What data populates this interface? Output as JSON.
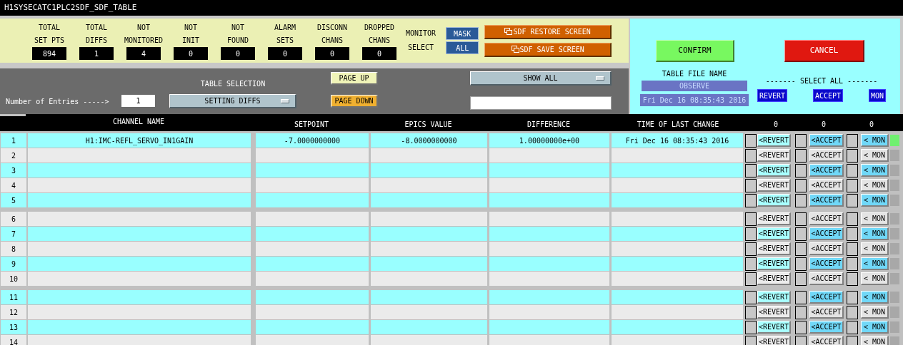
{
  "window": {
    "title": "H1SYSECATC1PLC2SDF_SDF_TABLE"
  },
  "stats": [
    {
      "label_1": "TOTAL",
      "label_2": "SET PTS",
      "value": "894"
    },
    {
      "label_1": "TOTAL",
      "label_2": "DIFFS",
      "value": "1"
    },
    {
      "label_1": "NOT",
      "label_2": "MONITORED",
      "value": "4"
    },
    {
      "label_1": "NOT",
      "label_2": "INIT",
      "value": "0"
    },
    {
      "label_1": "NOT",
      "label_2": "FOUND",
      "value": "0"
    },
    {
      "label_1": "ALARM",
      "label_2": "SETS",
      "value": "0"
    },
    {
      "label_1": "DISCONN",
      "label_2": "CHANS",
      "value": "0"
    },
    {
      "label_1": "DROPPED",
      "label_2": "CHANS",
      "value": "0"
    }
  ],
  "monitor_select": {
    "label_1": "MONITOR",
    "label_2": "SELECT",
    "buttons": [
      "MASK",
      "ALL"
    ]
  },
  "sdf_buttons": [
    "SDF RESTORE SCREEN",
    "SDF SAVE SCREEN"
  ],
  "confirm": "CONFIRM",
  "cancel": "CANCEL",
  "table_file": {
    "label": "TABLE FILE NAME",
    "name": "OBSERVE",
    "time": "Fri Dec 16 08:35:43 2016"
  },
  "select_all": {
    "label": "------- SELECT ALL -------",
    "buttons": [
      "REVERT",
      "ACCEPT",
      "MON"
    ]
  },
  "entries": {
    "label": "Number of Entries ----->",
    "value": "1"
  },
  "table_selection": {
    "label": "TABLE SELECTION",
    "value": "SETTING DIFFS"
  },
  "paging": [
    "PAGE UP",
    "PAGE DOWN"
  ],
  "filter": {
    "value": "SHOW ALL"
  },
  "table": {
    "columns": [
      "CHANNEL NAME",
      "SETPOINT",
      "EPICS VALUE",
      "DIFFERENCE",
      "TIME OF LAST CHANGE"
    ],
    "counts": [
      "0",
      "0",
      "0"
    ],
    "rows": [
      {
        "number": "1",
        "channel": "H1:IMC-REFL_SERVO_IN1GAIN",
        "setpoint": "-7.0000000000",
        "epics_value": "-8.0000000000",
        "difference": "1.00000000e+00",
        "time": "Fri Dec 16 08:35:43 2016",
        "highlighted": true,
        "status_on": true,
        "checks": [
          false,
          false,
          false
        ],
        "buttons": [
          "<REVERT",
          "<ACCEPT",
          "< MON"
        ]
      },
      {
        "number": "2",
        "highlighted": false,
        "status_on": false,
        "checks": [
          false,
          false,
          false
        ],
        "buttons": [
          "<REVERT",
          "<ACCEPT",
          "< MON"
        ]
      },
      {
        "number": "3",
        "highlighted": true,
        "status_on": false,
        "checks": [
          false,
          false,
          false
        ],
        "buttons": [
          "<REVERT",
          "<ACCEPT",
          "< MON"
        ]
      },
      {
        "number": "4",
        "highlighted": false,
        "status_on": false,
        "checks": [
          false,
          false,
          false
        ],
        "buttons": [
          "<REVERT",
          "<ACCEPT",
          "< MON"
        ]
      },
      {
        "number": "5",
        "highlighted": true,
        "status_on": false,
        "checks": [
          false,
          false,
          false
        ],
        "buttons": [
          "<REVERT",
          "<ACCEPT",
          "< MON"
        ]
      },
      {
        "number": "6",
        "highlighted": false,
        "status_on": false,
        "checks": [
          false,
          false,
          false
        ],
        "buttons": [
          "<REVERT",
          "<ACCEPT",
          "< MON"
        ]
      },
      {
        "number": "7",
        "highlighted": true,
        "status_on": false,
        "checks": [
          false,
          false,
          false
        ],
        "buttons": [
          "<REVERT",
          "<ACCEPT",
          "< MON"
        ]
      },
      {
        "number": "8",
        "highlighted": false,
        "status_on": false,
        "checks": [
          false,
          false,
          false
        ],
        "buttons": [
          "<REVERT",
          "<ACCEPT",
          "< MON"
        ]
      },
      {
        "number": "9",
        "highlighted": true,
        "status_on": false,
        "checks": [
          false,
          false,
          false
        ],
        "buttons": [
          "<REVERT",
          "<ACCEPT",
          "< MON"
        ]
      },
      {
        "number": "10",
        "highlighted": false,
        "status_on": false,
        "checks": [
          false,
          false,
          false
        ],
        "buttons": [
          "<REVERT",
          "<ACCEPT",
          "< MON"
        ]
      },
      {
        "number": "11",
        "highlighted": true,
        "status_on": false,
        "checks": [
          false,
          false,
          false
        ],
        "buttons": [
          "<REVERT",
          "<ACCEPT",
          "< MON"
        ]
      },
      {
        "number": "12",
        "highlighted": false,
        "status_on": false,
        "checks": [
          false,
          false,
          false
        ],
        "buttons": [
          "<REVERT",
          "<ACCEPT",
          "< MON"
        ]
      },
      {
        "number": "13",
        "highlighted": true,
        "status_on": false,
        "checks": [
          false,
          false,
          false
        ],
        "buttons": [
          "<REVERT",
          "<ACCEPT",
          "< MON"
        ]
      },
      {
        "number": "14",
        "highlighted": false,
        "status_on": false,
        "checks": [
          false,
          false,
          false
        ],
        "buttons": [
          "<REVERT",
          "<ACCEPT",
          "< MON"
        ]
      }
    ]
  }
}
